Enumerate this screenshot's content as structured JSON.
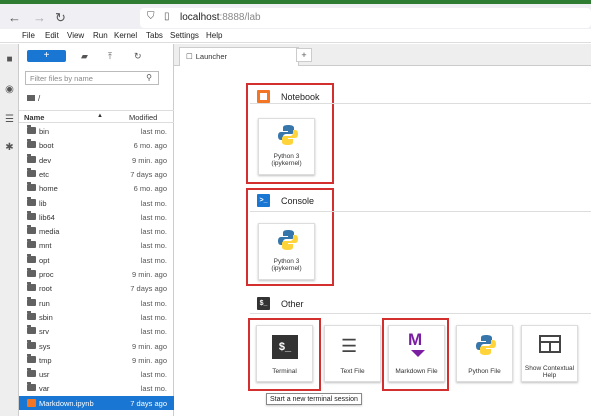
{
  "browser": {
    "url_host": "localhost",
    "url_path": ":8888/lab"
  },
  "menu": [
    "File",
    "Edit",
    "View",
    "Run",
    "Kernel",
    "Tabs",
    "Settings",
    "Help"
  ],
  "filebrowser": {
    "new_label": "+",
    "filter_placeholder": "Filter files by name",
    "breadcrumb": "/",
    "col_name": "Name",
    "col_modified": "Modified",
    "files": [
      {
        "name": "bin",
        "modified": "last mo."
      },
      {
        "name": "boot",
        "modified": "6 mo. ago"
      },
      {
        "name": "dev",
        "modified": "9 min. ago"
      },
      {
        "name": "etc",
        "modified": "7 days ago"
      },
      {
        "name": "home",
        "modified": "6 mo. ago"
      },
      {
        "name": "lib",
        "modified": "last mo."
      },
      {
        "name": "lib64",
        "modified": "last mo."
      },
      {
        "name": "media",
        "modified": "last mo."
      },
      {
        "name": "mnt",
        "modified": "last mo."
      },
      {
        "name": "opt",
        "modified": "last mo."
      },
      {
        "name": "proc",
        "modified": "9 min. ago"
      },
      {
        "name": "root",
        "modified": "7 days ago"
      },
      {
        "name": "run",
        "modified": "last mo."
      },
      {
        "name": "sbin",
        "modified": "last mo."
      },
      {
        "name": "srv",
        "modified": "last mo."
      },
      {
        "name": "sys",
        "modified": "9 min. ago"
      },
      {
        "name": "tmp",
        "modified": "9 min. ago"
      },
      {
        "name": "usr",
        "modified": "last mo."
      },
      {
        "name": "var",
        "modified": "last mo."
      },
      {
        "name": "Markdown.ipynb",
        "modified": "7 days ago"
      }
    ]
  },
  "tabs": {
    "launcher": "Launcher",
    "add": "+"
  },
  "launcher": {
    "notebook_title": "Notebook",
    "console_title": "Console",
    "other_title": "Other",
    "python_label_line1": "Python 3",
    "python_label_line2": "(ipykernel)",
    "terminal_label": "Terminal",
    "textfile_label": "Text File",
    "markdown_label": "Markdown File",
    "pythonfile_label": "Python File",
    "help_label": "Show Contextual Help",
    "tooltip": "Start a new terminal session"
  },
  "colors": {
    "accent": "#1976d2",
    "highlight_box": "#d32f2f",
    "jupyter_orange": "#f37626"
  }
}
